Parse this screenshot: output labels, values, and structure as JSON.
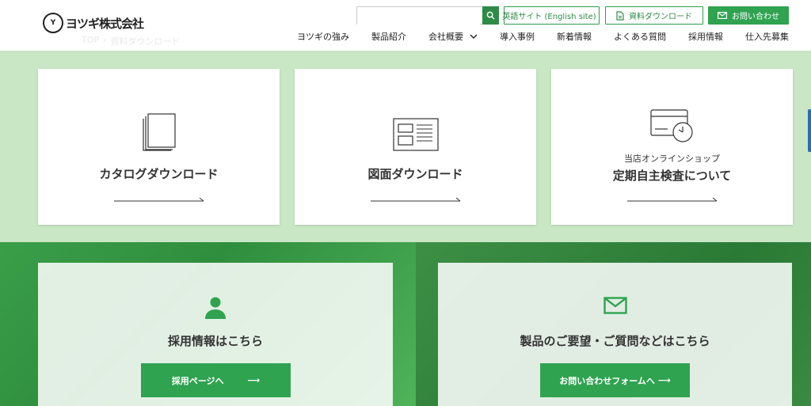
{
  "header": {
    "logo_text": "ヨツギ株式会社",
    "logo_mark": "Y",
    "breadcrumb": {
      "home": "TOP",
      "sep": "›",
      "current": "資料ダウンロード"
    },
    "search": {
      "placeholder": ""
    },
    "buttons": {
      "english": "英語サイト (English site)",
      "download": "資料ダウンロード",
      "contact": "お問い合わせ"
    },
    "nav": [
      {
        "label": "ヨツギの強み"
      },
      {
        "label": "製品紹介"
      },
      {
        "label": "会社概要"
      },
      {
        "label": "導入事例"
      },
      {
        "label": "新着情報"
      },
      {
        "label": "よくある質問"
      },
      {
        "label": "採用情報"
      },
      {
        "label": "仕入先募集"
      }
    ]
  },
  "cards": [
    {
      "title": "カタログダウンロード",
      "sub": ""
    },
    {
      "title": "図面ダウンロード",
      "sub": ""
    },
    {
      "title": "定期自主検査について",
      "sub": "当店オンラインショップ"
    }
  ],
  "panels": {
    "recruit": {
      "title": "採用情報はこちら",
      "button": "採用ページへ",
      "arrow": "⟶"
    },
    "inquiry": {
      "title": "製品のご要望・ご質問などはこちら",
      "button": "お問い合わせフォームへ",
      "arrow": "⟶"
    }
  },
  "colors": {
    "brand_green": "#2fa350",
    "light_green_bg": "#c9e6c5"
  },
  "icons": [
    "search-icon",
    "external-link-icon",
    "document-icon",
    "mail-icon",
    "chevron-down-icon",
    "catalog-icon",
    "drawing-icon",
    "card-clock-icon",
    "person-icon",
    "envelope-icon",
    "arrow-right-icon"
  ]
}
